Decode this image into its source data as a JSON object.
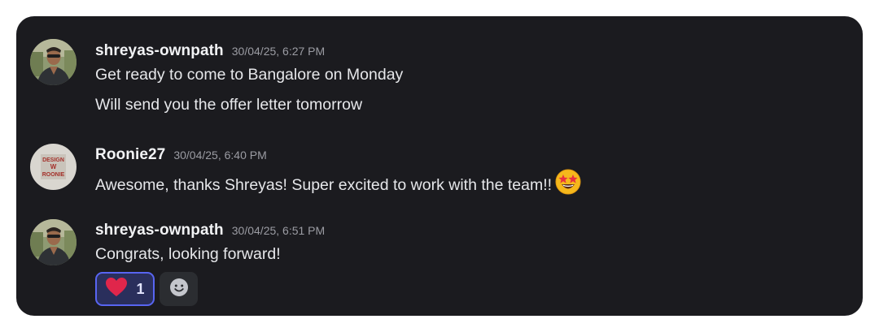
{
  "messages": [
    {
      "author": "shreyas-ownpath",
      "timestamp": "30/04/25, 6:27 PM",
      "lines": [
        "Get ready to come to Bangalore on Monday",
        "Will send you the offer letter tomorrow"
      ]
    },
    {
      "author": "Roonie27",
      "timestamp": "30/04/25, 6:40 PM",
      "avatar_logo_text": "DESIGN W ROONIE",
      "lines": [
        "Awesome, thanks Shreyas! Super excited to work with the team!!"
      ],
      "emoji": "star-struck-emoji"
    },
    {
      "author": "shreyas-ownpath",
      "timestamp": "30/04/25, 6:51 PM",
      "lines": [
        "Congrats, looking forward!"
      ],
      "reactions": [
        {
          "icon": "heart-icon",
          "count": "1",
          "selected": true
        },
        {
          "icon": "add-reaction-icon"
        }
      ]
    }
  ],
  "colors": {
    "background": "#1b1b1f",
    "username": "#f2f3f5",
    "timestamp": "#9b9ca3",
    "text": "#e6e7ea",
    "reaction_selected_border": "#5865f2",
    "reaction_selected_bg": "#2a2f5c",
    "heart": "#e0264b"
  }
}
